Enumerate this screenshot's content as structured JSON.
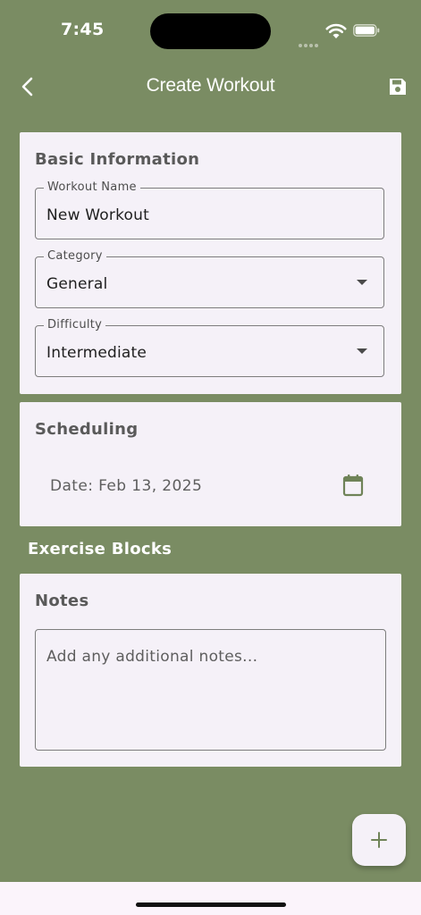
{
  "status_bar": {
    "time": "7:45"
  },
  "app_bar": {
    "title": "Create Workout"
  },
  "basic_info": {
    "title": "Basic Information",
    "workout_name": {
      "label": "Workout Name",
      "value": "New Workout"
    },
    "category": {
      "label": "Category",
      "value": "General"
    },
    "difficulty": {
      "label": "Difficulty",
      "value": "Intermediate"
    }
  },
  "scheduling": {
    "title": "Scheduling",
    "date_text": "Date: Feb 13, 2025"
  },
  "exercise_blocks": {
    "title": "Exercise Blocks"
  },
  "notes": {
    "title": "Notes",
    "placeholder": "Add any additional notes..."
  },
  "icons": {
    "back": "chevron-left-icon",
    "save": "floppy-disk-icon",
    "calendar": "calendar-icon",
    "add": "plus-icon",
    "dropdown": "caret-down-icon"
  },
  "colors": {
    "background": "#7a8c63",
    "card": "#f5f1f8",
    "accent": "#6f8358"
  }
}
